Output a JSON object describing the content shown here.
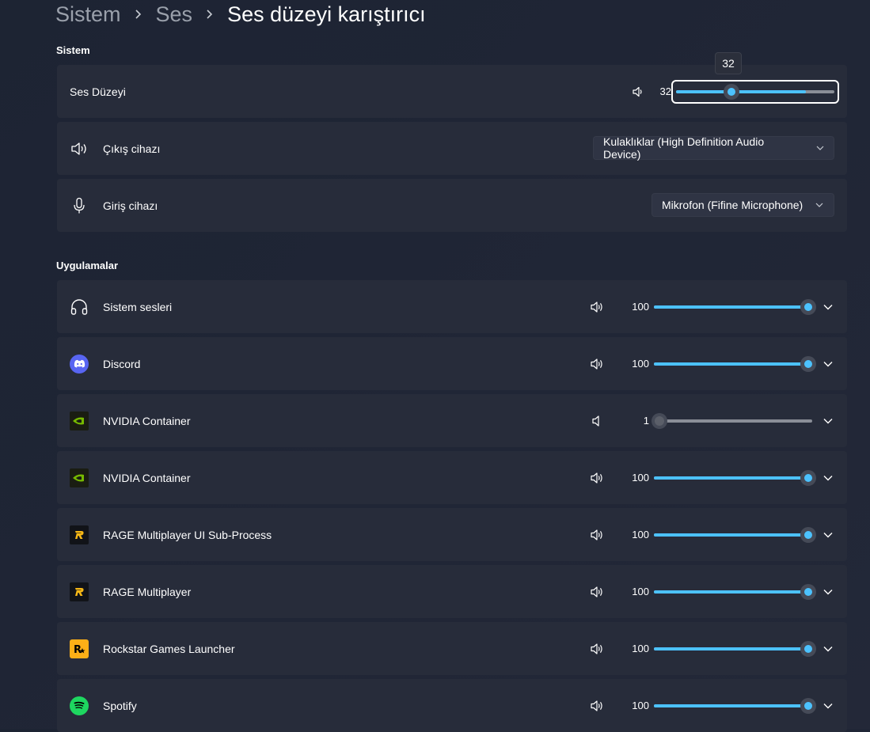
{
  "breadcrumb": [
    "Sistem",
    "Ses",
    "Ses düzeyi karıştırıcı"
  ],
  "sections": {
    "system": "Sistem",
    "apps": "Uygulamalar"
  },
  "system": {
    "volume_label": "Ses Düzeyi",
    "volume_value": "32",
    "volume_level": 32,
    "tooltip": "32",
    "output_label": "Çıkış cihazı",
    "output_device": "Kulaklıklar (High Definition Audio Device)",
    "input_label": "Giriş cihazı",
    "input_device": "Mikrofon (Fifine Microphone)"
  },
  "apps": [
    {
      "name": "Sistem sesleri",
      "value": "100",
      "level": 100,
      "icon": "headphones-icon"
    },
    {
      "name": "Discord",
      "value": "100",
      "level": 100,
      "icon": "discord-icon"
    },
    {
      "name": "NVIDIA Container",
      "value": "1",
      "level": 1,
      "icon": "nvidia-icon"
    },
    {
      "name": "NVIDIA Container",
      "value": "100",
      "level": 100,
      "icon": "nvidia-icon"
    },
    {
      "name": "RAGE Multiplayer UI Sub-Process",
      "value": "100",
      "level": 100,
      "icon": "rage-icon"
    },
    {
      "name": "RAGE Multiplayer",
      "value": "100",
      "level": 100,
      "icon": "rage-icon"
    },
    {
      "name": "Rockstar Games Launcher",
      "value": "100",
      "level": 100,
      "icon": "rockstar-icon"
    },
    {
      "name": "Spotify",
      "value": "100",
      "level": 100,
      "icon": "spotify-icon"
    }
  ],
  "colors": {
    "accent": "#4cc2ff",
    "card": "#272c3a",
    "discord": "#5865f2",
    "nvidia": "#76b900",
    "spotify": "#1ed760",
    "rockstar": "#fcaf17"
  }
}
